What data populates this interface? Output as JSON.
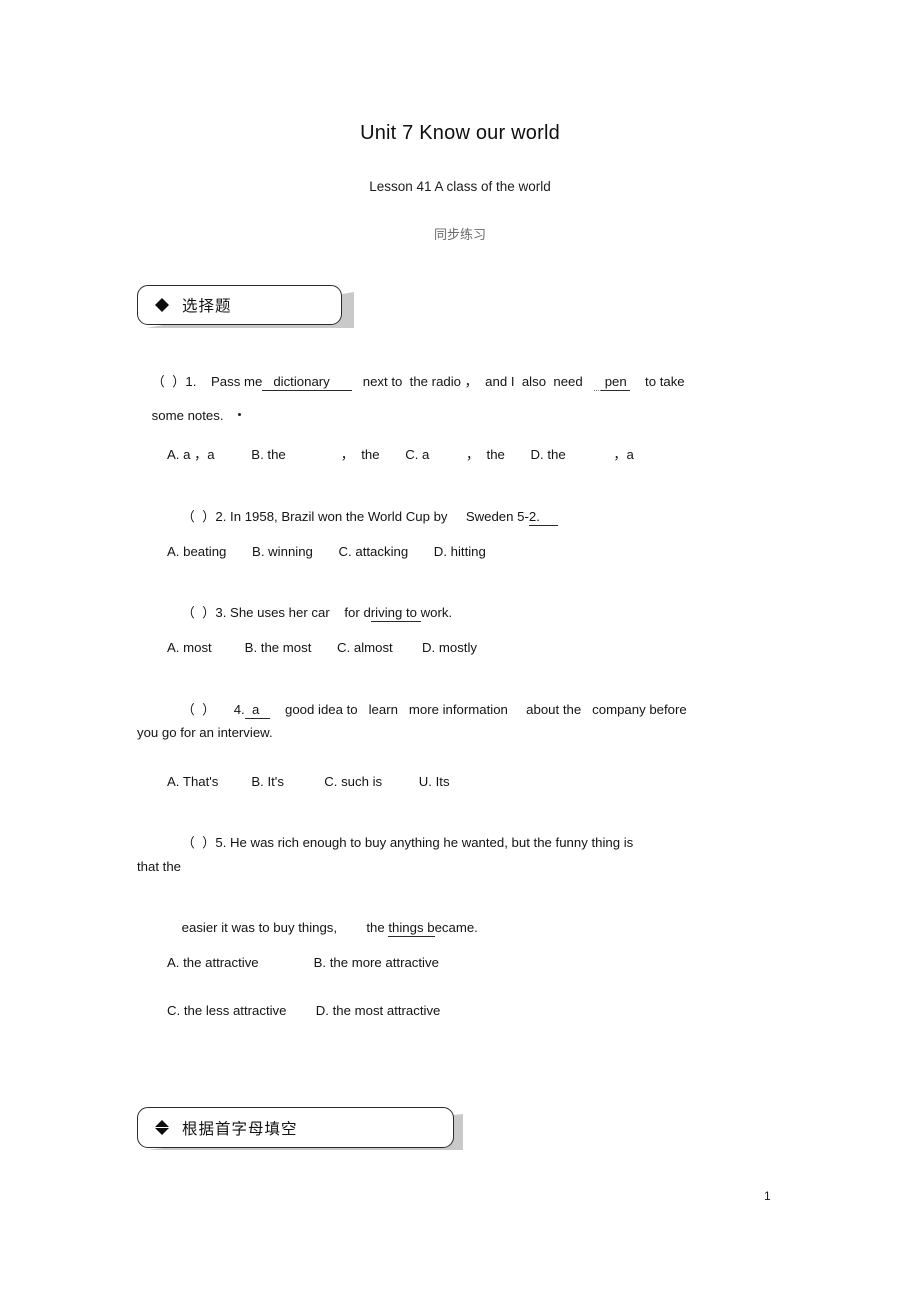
{
  "document": {
    "title": "Unit 7 Know our world",
    "subtitle": "Lesson 41 A class of the world",
    "subsubtitle": "同步练习",
    "page_number": "1"
  },
  "sections": [
    {
      "bullet": "diamond-bullet-icon",
      "label": "选择题"
    },
    {
      "bullet": "diamond-bullet-icon",
      "label": "根据首字母填空"
    }
  ],
  "questions": [
    {
      "marker": "（  ）1.",
      "stem_pre": "Pass me",
      "blank1": "dictionary",
      "stem_mid": "next to  the radio ，  and I  also  need",
      "blank2": "pen",
      "stem_post": "to take",
      "wrap": "some notes.",
      "options_line": "A. a ，a          B. the               ，  the       C. a          ，  the       D. the             ，a"
    },
    {
      "marker": "（  ）2.",
      "stem": "In 1958, Brazil won the World Cup by     Sweden 5-",
      "blank": "2.",
      "options_line": "A. beating       B. winning       C. attacking       D. hitting"
    },
    {
      "marker": "（  ）3.",
      "stem_pre": "She uses her car",
      "stem_mid": "for d",
      "underlined": "riving to ",
      "stem_post": "work.",
      "options_line": "A. most         B. the most       C. almost        D. mostly"
    },
    {
      "marker": "（  ）",
      "number": "4.",
      "blank": "a",
      "stem": "good idea to   learn   more information     about the   company before",
      "wrap": "you go for an interview.",
      "options_line": "A. That's         B. It's           C. such is          U. Its"
    },
    {
      "marker": "（  ）5.",
      "stem": "He was rich enough to buy anything he wanted, but the funny thing is",
      "wrap": "that the",
      "line2_pre": "easier it was to buy things,",
      "line2_mid": "the ",
      "line2_underlined": "things b",
      "line2_post": "ecame.",
      "options_row1": "A. the attractive               B. the more attractive",
      "options_row2": "C. the less attractive        D. the most attractive"
    }
  ]
}
